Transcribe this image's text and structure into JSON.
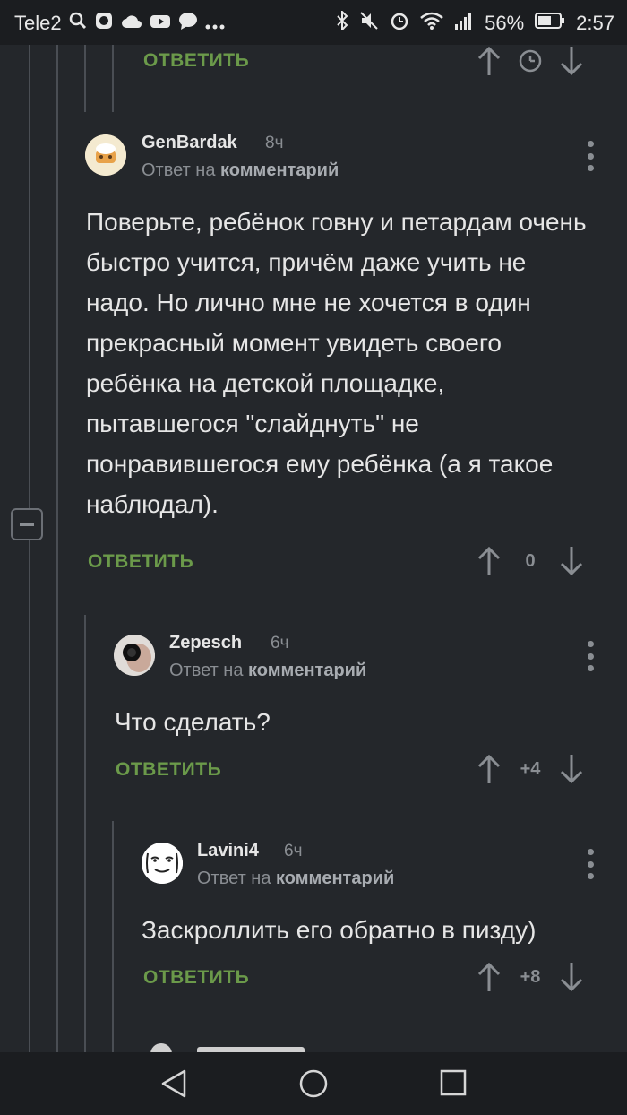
{
  "status_bar": {
    "carrier": "Tele2",
    "battery": "56%",
    "time": "2:57"
  },
  "top_partial": {
    "reply_label": "ОТВЕТИТЬ"
  },
  "comments": [
    {
      "author": "GenBardak",
      "time": "8ч",
      "reply_prefix": "Ответ на",
      "reply_target": "комментарий",
      "text": "Поверьте, ребёнок говну и петардам очень быстро учится, причём даже учить не надо. Но лично мне не хочется в один прекрасный момент увидеть своего ребёнка на детской площадке, пытавшегося \"слайднуть\" не понравившегося ему ребёнка (а я такое наблюдал).",
      "reply_label": "ОТВЕТИТЬ",
      "score": "0"
    },
    {
      "author": "Zepesch",
      "time": "6ч",
      "reply_prefix": "Ответ на",
      "reply_target": "комментарий",
      "text": "Что сделать?",
      "reply_label": "ОТВЕТИТЬ",
      "score": "+4"
    },
    {
      "author": "Lavini4",
      "time": "6ч",
      "reply_prefix": "Ответ на",
      "reply_target": "комментарий",
      "text": "Заскроллить его обратно в пизду)",
      "reply_label": "ОТВЕТИТЬ",
      "score": "+8"
    }
  ],
  "colors": {
    "background": "#24272b",
    "reply_green": "#6b9a4a",
    "muted": "#8a8e93"
  }
}
